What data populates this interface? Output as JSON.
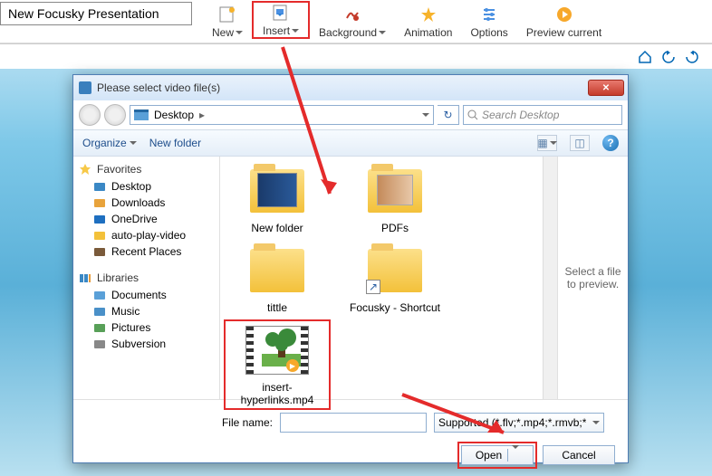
{
  "app": {
    "title_input": "New Focusky Presentation"
  },
  "ribbon": {
    "new": "New",
    "insert": "Insert",
    "background": "Background",
    "animation": "Animation",
    "options": "Options",
    "preview": "Preview current"
  },
  "dialog": {
    "title": "Please select video file(s)",
    "address": "Desktop",
    "address_sep": "▸",
    "search_placeholder": "Search Desktop",
    "organize": "Organize",
    "new_folder": "New folder",
    "preview_hint": "Select a file to preview.",
    "file_name_label": "File name:",
    "file_name_value": "",
    "filter": "Supported (*.flv;*.mp4;*.rmvb;*",
    "open": "Open",
    "cancel": "Cancel"
  },
  "sidebar": {
    "favorites": "Favorites",
    "items_fav": [
      {
        "label": "Desktop",
        "icon": "desktop",
        "color": "#3a88c5"
      },
      {
        "label": "Downloads",
        "icon": "downloads",
        "color": "#e8a33c"
      },
      {
        "label": "OneDrive",
        "icon": "cloud",
        "color": "#1e6fc0"
      },
      {
        "label": "auto-play-video",
        "icon": "folder",
        "color": "#f3c13a"
      },
      {
        "label": "Recent Places",
        "icon": "recent",
        "color": "#7a5a3a"
      }
    ],
    "libraries": "Libraries",
    "items_lib": [
      {
        "label": "Documents",
        "icon": "doc",
        "color": "#5aa0d8"
      },
      {
        "label": "Music",
        "icon": "music",
        "color": "#4a90c8"
      },
      {
        "label": "Pictures",
        "icon": "pic",
        "color": "#58a058"
      },
      {
        "label": "Subversion",
        "icon": "svn",
        "color": "#888"
      }
    ]
  },
  "files": [
    {
      "name": "New folder",
      "type": "folder",
      "sel": false
    },
    {
      "name": "PDFs",
      "type": "folder-pdf",
      "sel": false
    },
    {
      "name": "tittle",
      "type": "folder",
      "sel": false
    },
    {
      "name": "Focusky - Shortcut",
      "type": "shortcut",
      "sel": false
    },
    {
      "name": "insert-hyperlinks.mp4",
      "type": "video",
      "sel": true
    }
  ]
}
